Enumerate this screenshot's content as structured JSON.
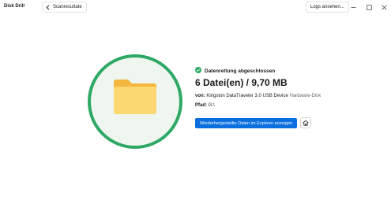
{
  "window": {
    "app_title": "Disk Drill",
    "back_label": "Scanresultate",
    "logs_label": "Logs ansehen..."
  },
  "result": {
    "status": "Datenrettung abgeschlossen",
    "headline": "6 Datei(en) / 9,70 MB",
    "source_label": "von:",
    "source_device": "Kingston DataTraveler 3.0 USB Device",
    "source_type": "Hardware-Disk",
    "path_label": "Pfad:",
    "path_value": "G:\\",
    "explorer_button": "Wiederhergestellte Daten im Explorer anzeigen"
  },
  "colors": {
    "accent_green": "#2ea865",
    "circle_fill": "#eef6ef",
    "primary_blue": "#0b6fe0",
    "folder_yellow": "#fcd873",
    "folder_tab": "#f3b63e"
  },
  "icons": {
    "back": "chevron-left-icon",
    "status": "check-circle-icon",
    "folder": "folder-icon",
    "home": "home-icon",
    "minimize": "minimize-icon",
    "maximize": "maximize-icon",
    "close": "close-icon"
  }
}
